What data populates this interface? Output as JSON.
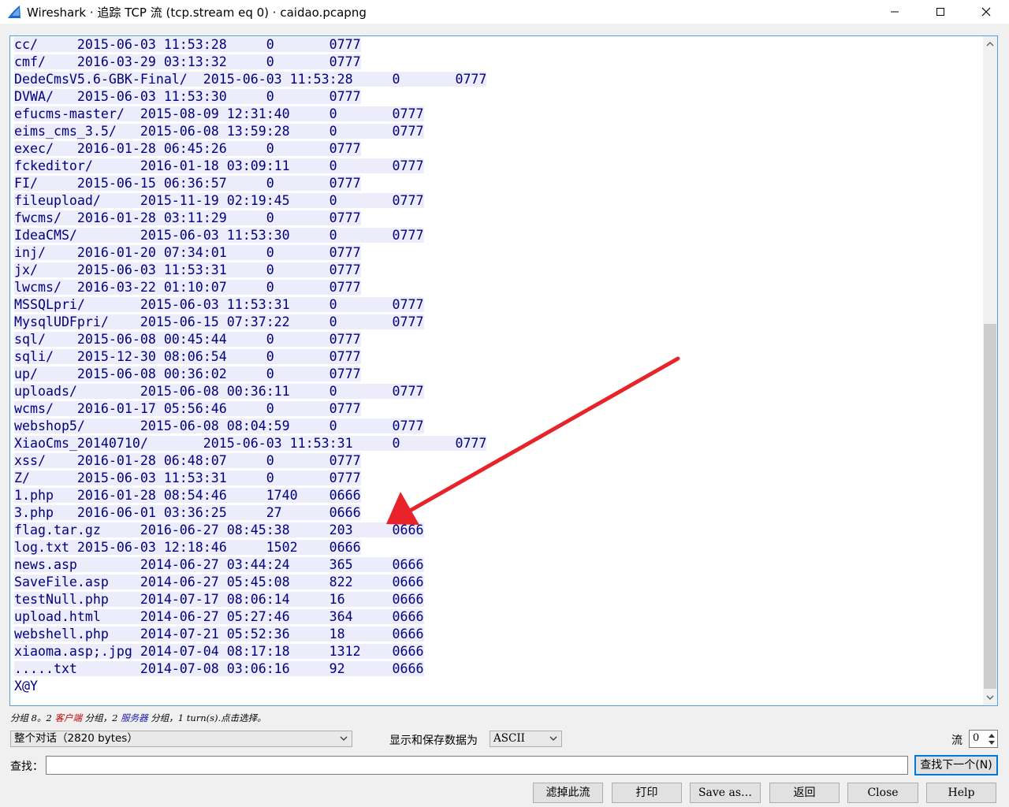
{
  "window": {
    "title": "Wireshark · 追踪 TCP 流 (tcp.stream eq 0) · caidao.pcapng",
    "app_icon": "wireshark-fin-icon",
    "accent_color": "#0078d7"
  },
  "stream": {
    "text_color": "#00007f",
    "highlight_color": "#ececfa",
    "lines": [
      "cc/\t2015-06-03 11:53:28\t0\t0777",
      "cmf/\t2016-03-29 03:13:32\t0\t0777",
      "DedeCmsV5.6-GBK-Final/\t2015-06-03 11:53:28\t0\t0777",
      "DVWA/\t2015-06-03 11:53:30\t0\t0777",
      "efucms-master/\t2015-08-09 12:31:40\t0\t0777",
      "eims_cms_3.5/\t2015-06-08 13:59:28\t0\t0777",
      "exec/\t2016-01-28 06:45:26\t0\t0777",
      "fckeditor/\t2016-01-18 03:09:11\t0\t0777",
      "FI/\t2015-06-15 06:36:57\t0\t0777",
      "fileupload/\t2015-11-19 02:19:45\t0\t0777",
      "fwcms/\t2016-01-28 03:11:29\t0\t0777",
      "IdeaCMS/\t2015-06-03 11:53:30\t0\t0777",
      "inj/\t2016-01-20 07:34:01\t0\t0777",
      "jx/\t2015-06-03 11:53:31\t0\t0777",
      "lwcms/\t2016-03-22 01:10:07\t0\t0777",
      "MSSQLpri/\t2015-06-03 11:53:31\t0\t0777",
      "MysqlUDFpri/\t2015-06-15 07:37:22\t0\t0777",
      "sql/\t2015-06-08 00:45:44\t0\t0777",
      "sqli/\t2015-12-30 08:06:54\t0\t0777",
      "up/\t2015-06-08 00:36:02\t0\t0777",
      "uploads/\t2015-06-08 00:36:11\t0\t0777",
      "wcms/\t2016-01-17 05:56:46\t0\t0777",
      "webshop5/\t2015-06-08 08:04:59\t0\t0777",
      "XiaoCms_20140710/\t2015-06-03 11:53:31\t0\t0777",
      "xss/\t2016-01-28 06:48:07\t0\t0777",
      "Z/\t2015-06-03 11:53:31\t0\t0777",
      "1.php\t2016-01-28 08:54:46\t1740\t0666",
      "3.php\t2016-06-01 03:36:25\t27\t0666",
      "flag.tar.gz\t2016-06-27 08:45:38\t203\t0666",
      "log.txt\t2015-06-03 12:18:46\t1502\t0666",
      "news.asp\t2014-06-27 03:44:24\t365\t0666",
      "SaveFile.asp\t2014-06-27 05:45:08\t822\t0666",
      "testNull.php\t2014-07-17 08:06:14\t16\t0666",
      "upload.html\t2014-06-27 05:27:46\t364\t0666",
      "webshell.php\t2014-07-21 05:52:36\t18\t0666",
      "xiaoma.asp;.jpg\t2014-07-04 08:17:18\t1312\t0666",
      ".....txt\t2014-07-08 03:06:16\t92\t0666"
    ],
    "trailer": "X@Y"
  },
  "annotation": {
    "arrow_color": "#e8232a",
    "arrow_icon": "red-annotation-arrow-icon"
  },
  "status": {
    "prefix": "分组 8。2 ",
    "client": "客户端",
    "mid": " 分组，2 ",
    "server": "服务器",
    "suffix": " 分组，1 turn(s).点击选择。",
    "client_color": "#c00000",
    "server_color": "#1a1ab0"
  },
  "controls": {
    "conversation_value": "整个对话（2820 bytes）",
    "format_label": "显示和保存数据为",
    "format_value": "ASCII",
    "stream_label": "流",
    "stream_value": "0",
    "find_label": "查找：",
    "find_placeholder": "",
    "find_next_label": "查找下一个(N)"
  },
  "buttons": {
    "filter_out": "滤掉此流",
    "print": "打印",
    "save_as": "Save as…",
    "back": "返回",
    "close": "Close",
    "help": "Help"
  }
}
